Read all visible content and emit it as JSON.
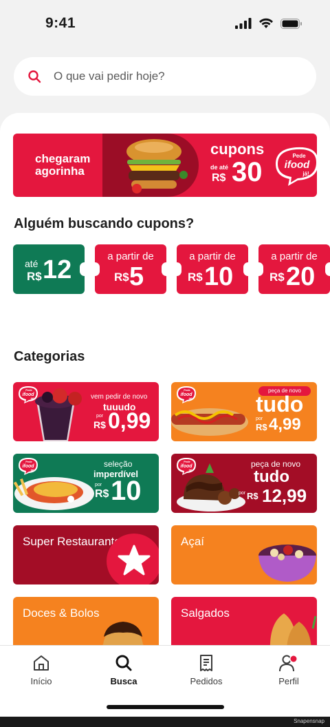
{
  "status": {
    "time": "9:41"
  },
  "search": {
    "placeholder": "O que vai pedir hoje?"
  },
  "hero": {
    "left_line1": "chegaram",
    "left_line2": "agorinha",
    "title": "cupons",
    "ate_line1": "de até",
    "currency": "R$",
    "amount": "30",
    "badge_line1": "Pede",
    "badge_line2": "ifood",
    "badge_line3": "já!"
  },
  "coupons_section": {
    "title": "Alguém buscando cupons?",
    "items": [
      {
        "top": "até",
        "currency": "R$",
        "value": "12",
        "color": "#0f7a55"
      },
      {
        "top": "a partir de",
        "currency": "R$",
        "value": "5",
        "color": "#e4173e"
      },
      {
        "top": "a partir de",
        "currency": "R$",
        "value": "10",
        "color": "#e4173e"
      },
      {
        "top": "a partir de",
        "currency": "R$",
        "value": "20",
        "color": "#e4173e"
      }
    ]
  },
  "categories": {
    "title": "Categorias",
    "promo1": {
      "line1": "vem pedir de novo",
      "line2": "tuuudo",
      "por": "por",
      "currency": "R$",
      "price": "0,99"
    },
    "promo2": {
      "tag": "peça de novo",
      "line2": "tudo",
      "por": "por",
      "currency": "R$",
      "price": "4,99"
    },
    "promo3": {
      "line1": "seleção",
      "line2": "imperdível",
      "por": "por",
      "currency": "R$",
      "price": "10"
    },
    "promo4": {
      "line1": "peça de novo",
      "line2": "tudo",
      "por": "por",
      "currency": "R$",
      "price": "12,99"
    },
    "logo": {
      "l1": "Pede",
      "l2": "ifood",
      "l3": "já!"
    },
    "cards": [
      {
        "label": "Super Restaurantes",
        "color": "#a30d26"
      },
      {
        "label": "Açaí",
        "color": "#f5821f"
      },
      {
        "label": "Doces & Bolos",
        "color": "#f5821f"
      },
      {
        "label": "Salgados",
        "color": "#e4173e"
      }
    ]
  },
  "tabbar": {
    "tabs": [
      {
        "label": "Início",
        "icon": "home-icon"
      },
      {
        "label": "Busca",
        "icon": "search-icon",
        "active": true
      },
      {
        "label": "Pedidos",
        "icon": "receipt-icon"
      },
      {
        "label": "Perfil",
        "icon": "profile-icon",
        "badge": true
      }
    ]
  },
  "watermark": "Snapensnap",
  "colors": {
    "brand_red": "#e4173e",
    "dark_red": "#a30d26",
    "green": "#0f7a55",
    "orange": "#f5821f"
  }
}
